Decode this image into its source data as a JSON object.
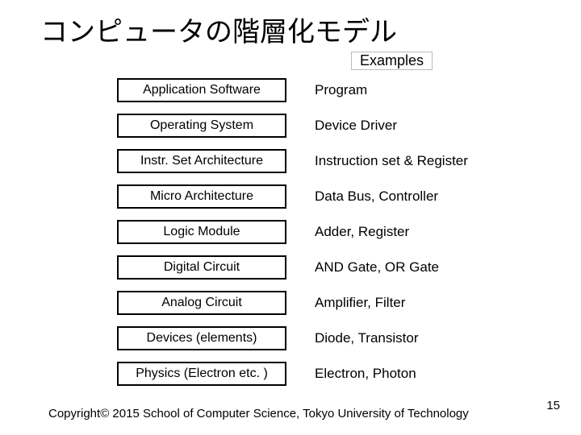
{
  "title": "コンピュータの階層化モデル",
  "examples_header": "Examples",
  "layers": [
    {
      "name": "Application Software",
      "example": "Program"
    },
    {
      "name": "Operating System",
      "example": "Device Driver"
    },
    {
      "name": "Instr. Set Architecture",
      "example": "Instruction set & Register"
    },
    {
      "name": "Micro Architecture",
      "example": "Data Bus, Controller"
    },
    {
      "name": "Logic Module",
      "example": "Adder, Register"
    },
    {
      "name": "Digital Circuit",
      "example": "AND Gate, OR Gate"
    },
    {
      "name": "Analog Circuit",
      "example": "Amplifier, Filter"
    },
    {
      "name": "Devices (elements)",
      "example": "Diode, Transistor"
    },
    {
      "name": "Physics (Electron etc. )",
      "example": "Electron, Photon"
    }
  ],
  "copyright": "Copyright© 2015  School of Computer Science, Tokyo University of Technology",
  "page_number": "15"
}
